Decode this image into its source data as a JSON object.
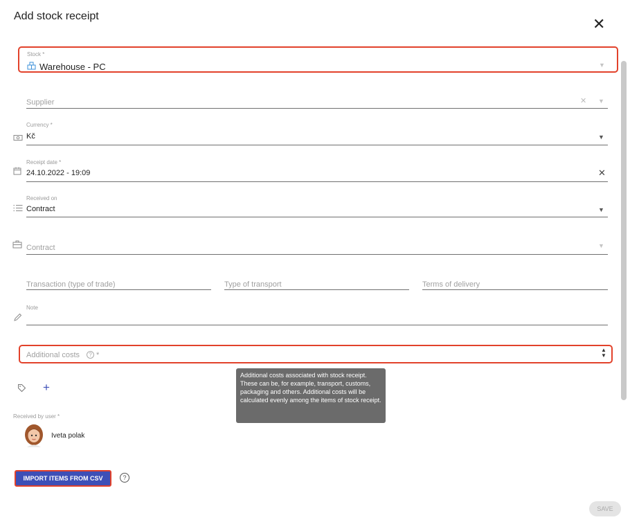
{
  "dialog": {
    "title": "Add stock receipt",
    "close_symbol": "✕"
  },
  "stock": {
    "label": "Stock *",
    "value": "Warehouse - PC",
    "icon": "warehouse-icon"
  },
  "supplier": {
    "placeholder": "Supplier",
    "clear_symbol": "✕"
  },
  "currency": {
    "label": "Currency *",
    "value": "Kč",
    "icon": "money-icon"
  },
  "receipt_date": {
    "label": "Receipt date *",
    "value": "24.10.2022 - 19:09",
    "icon": "calendar-icon",
    "clear_symbol": "✕"
  },
  "received_on": {
    "label": "Received on",
    "value": "Contract",
    "icon": "list-icon"
  },
  "contract": {
    "placeholder": "Contract",
    "icon": "briefcase-icon"
  },
  "transaction": {
    "placeholder": "Transaction (type of trade)"
  },
  "transport": {
    "placeholder": "Type of transport"
  },
  "terms": {
    "placeholder": "Terms of delivery"
  },
  "note": {
    "label": "Note",
    "icon": "pencil-icon"
  },
  "additional_costs": {
    "placeholder": "Additional costs",
    "required_mark": "*",
    "help_symbol": "?"
  },
  "tooltip": {
    "text": "Additional costs associated with stock receipt. These can be, for example, transport, customs, packaging and others. Additional costs will be calculated evenly among the items of stock receipt."
  },
  "tags": {
    "icon": "tag-icon",
    "add_symbol": "+"
  },
  "received_by": {
    "label": "Received by user *",
    "user_name": "Iveta polak"
  },
  "import_button": {
    "label": "IMPORT ITEMS FROM CSV"
  },
  "help_button": {
    "symbol": "?"
  },
  "save_button": {
    "label": "SAVE"
  },
  "colors": {
    "accent": "#3d4fb7",
    "highlight": "#e2412a",
    "tooltip_bg": "#6b6b6b"
  }
}
